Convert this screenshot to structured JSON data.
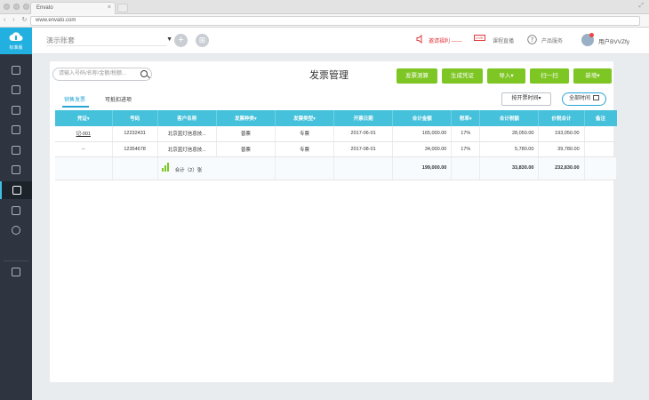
{
  "browser": {
    "tab_title": "Envato",
    "tab_close": "×",
    "url": "www.envato.com",
    "nav_glyphs": "‹ › ↻",
    "resize_glyph": "⤢"
  },
  "sidebar": {
    "logo_text": "标准版",
    "items": [
      {
        "icon": "book-icon"
      },
      {
        "icon": "upload-icon"
      },
      {
        "icon": "chart-icon"
      },
      {
        "icon": "building-icon"
      },
      {
        "icon": "ledger-icon"
      },
      {
        "icon": "report-icon"
      },
      {
        "icon": "invoice-icon",
        "active": true
      },
      {
        "icon": "stamp-icon"
      },
      {
        "icon": "settings-icon"
      },
      {
        "icon": "archive-icon"
      }
    ]
  },
  "topbar": {
    "account_select": "演示账套",
    "caret": "▼",
    "add_glyph": "+",
    "grid_glyph": "⊞",
    "promo_link": "邀请福利 ——",
    "live_badge": "LIVE",
    "live_text": "课程直播",
    "product_service": "产品服务",
    "user_name": "用户BVVZfy",
    "colors": {
      "accent": "#22b0e0",
      "alert": "#e0393e"
    }
  },
  "main": {
    "title": "发票管理",
    "search_placeholder": "请输入号码/名称/金额/税额...",
    "buttons": {
      "invoice_calc": "发票测算",
      "gen_voucher": "生成凭证",
      "import": "导入▾",
      "scan": "扫一扫",
      "add": "新增▾"
    },
    "tabs": {
      "sales": "销售发票",
      "deduct": "可抵扣进项"
    },
    "sort_by": "按开票时间▾",
    "all_time": "全部时间",
    "button_color": "#7dc623",
    "header_color": "#46c1db"
  },
  "table": {
    "columns": [
      "凭证▾",
      "号码",
      "客户名称",
      "发票种类▾",
      "发票类型▾",
      "开票日期",
      "合计金额",
      "税率▾",
      "合计税额",
      "价税合计",
      "备注"
    ],
    "rows": [
      {
        "voucher": "记-001",
        "number": "12232431",
        "customer": "北京蓝灯信息技...",
        "kind": "普票",
        "type": "专票",
        "date": "2017-06-01",
        "amount": "165,000.00",
        "rate": "17%",
        "tax": "28,050.00",
        "total": "193,050.00",
        "note": ""
      },
      {
        "voucher": "--",
        "number": "12354678",
        "customer": "北京蓝灯信息技...",
        "kind": "普票",
        "type": "专票",
        "date": "2017-08-01",
        "amount": "34,000.00",
        "rate": "17%",
        "tax": "5,780.00",
        "total": "39,780.00",
        "note": ""
      }
    ],
    "total": {
      "label": "合计（2）张",
      "amount": "199,000.00",
      "tax": "33,830.00",
      "total": "232,830.00"
    }
  }
}
